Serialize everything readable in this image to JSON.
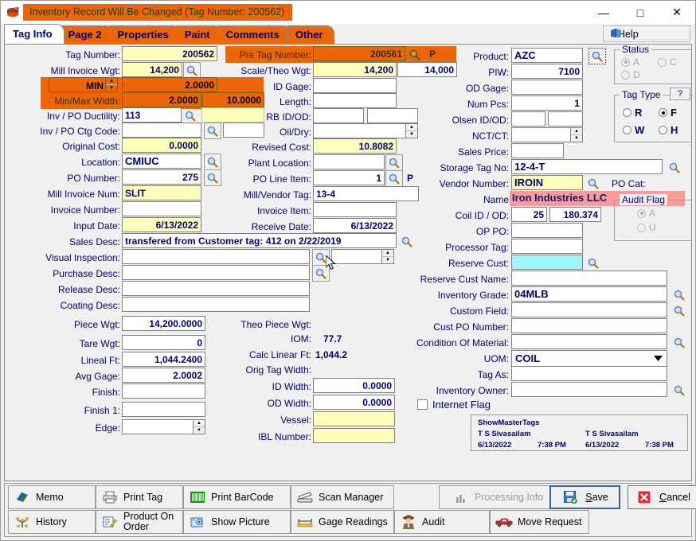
{
  "window": {
    "title": "Inventory Record Will Be Changed  (Tag Number: 200562)",
    "icon": "inventory-icon",
    "minimize": "—",
    "maximize": "□",
    "close": "✕"
  },
  "tabs": [
    {
      "label": "Tag Info",
      "active": true
    },
    {
      "label": "Page 2",
      "active": false
    },
    {
      "label": "Properties",
      "active": false
    },
    {
      "label": "Paint",
      "active": false
    },
    {
      "label": "Comments",
      "active": false
    },
    {
      "label": "Other",
      "active": false
    }
  ],
  "help": {
    "label": "Help"
  },
  "col1": {
    "tag_number": {
      "label": "Tag Number:",
      "value": "200562"
    },
    "mill_invoice_wgt": {
      "label": "Mill Invoice Wgt:",
      "value": "14,200"
    },
    "min": {
      "label": "MIN",
      "value": "2.0000"
    },
    "min_max_width": {
      "label": "Min/Max Width:",
      "min": "2.0000",
      "max": "10.0000"
    },
    "inv_po_ductility": {
      "label": "Inv / PO Ductility:",
      "value": "113",
      "value2": ""
    },
    "inv_po_ctg_code": {
      "label": "Inv / PO Ctg Code:",
      "value": "",
      "value2": ""
    },
    "original_cost": {
      "label": "Original Cost:",
      "value": "0.0000"
    },
    "location": {
      "label": "Location:",
      "value": "CMIUC"
    },
    "po_number": {
      "label": "PO Number:",
      "value": "275"
    },
    "mill_invoice_num": {
      "label": "Mill Invoice Num:",
      "value": "SLIT"
    },
    "invoice_number": {
      "label": "Invoice Number:",
      "value": ""
    },
    "input_date": {
      "label": "Input Date:",
      "value": "6/13/2022"
    },
    "sales_desc": {
      "label": "Sales Desc:",
      "value": "transfered from Customer tag: 412 on  2/22/2019"
    },
    "visual_inspection": {
      "label": "Visual Inspection:",
      "value": ""
    },
    "purchase_desc": {
      "label": "Purchase Desc:",
      "value": ""
    },
    "release_desc": {
      "label": "Release Desc:",
      "value": ""
    },
    "coating_desc": {
      "label": "Coating Desc:",
      "value": ""
    },
    "piece_wgt": {
      "label": "Piece Wgt:",
      "value": "14,200.0000"
    },
    "tare_wgt": {
      "label": "Tare Wgt:",
      "value": "0"
    },
    "lineal_ft": {
      "label": "Lineal Ft:",
      "value": "1,044.2400"
    },
    "avg_gage": {
      "label": "Avg Gage:",
      "value": "2.0002"
    },
    "finish": {
      "label": "Finish:",
      "value": ""
    },
    "finish_1": {
      "label": "Finish 1:",
      "value": ""
    },
    "edge": {
      "label": "Edge:",
      "value": ""
    }
  },
  "col2": {
    "pre_tag_number": {
      "label": "Pre Tag Number:",
      "value": "200561",
      "suffix": "P"
    },
    "scale_theo_wgt": {
      "label": "Scale/Theo Wgt:",
      "scale": "14,200",
      "theo": "14,000"
    },
    "id_gage": {
      "label": "ID Gage:",
      "value": ""
    },
    "length": {
      "label": "Length:",
      "value": ""
    },
    "rb_id_od": {
      "label": "RB ID/OD:",
      "id": "",
      "od": ""
    },
    "oil_dry": {
      "label": "Oil/Dry:",
      "value": ""
    },
    "revised_cost": {
      "label": "Revised Cost:",
      "value": "10.8082"
    },
    "plant_location": {
      "label": "Plant Location:",
      "value": ""
    },
    "po_line_item": {
      "label": "PO Line Item:",
      "value": "1",
      "suffix": "P"
    },
    "mill_vendor_tag": {
      "label": "Mill/Vendor Tag:",
      "value": "13-4"
    },
    "invoice_item": {
      "label": "Invoice Item:",
      "value": ""
    },
    "receive_date": {
      "label": "Receive Date:",
      "value": "6/13/2022"
    },
    "theo_piece_wgt": {
      "label": "Theo Piece Wgt:",
      "value": ""
    },
    "iom": {
      "label": "IOM:",
      "value": "77.7"
    },
    "calc_linear_ft": {
      "label": "Calc Linear Ft:",
      "value": "1,044.2"
    },
    "orig_tag_width": {
      "label": "Orig Tag Width:",
      "value": ""
    },
    "id_width": {
      "label": "ID Width:",
      "value": "0.0000"
    },
    "od_width": {
      "label": "OD Width:",
      "value": "0.0000"
    },
    "vessel": {
      "label": "Vessel:",
      "value": ""
    },
    "ibl_number": {
      "label": "IBL Number:",
      "value": ""
    }
  },
  "col3": {
    "product": {
      "label": "Product:",
      "value": "AZC"
    },
    "piw": {
      "label": "PIW:",
      "value": "7100"
    },
    "od_gage": {
      "label": "OD Gage:",
      "value": ""
    },
    "num_pcs": {
      "label": "Num Pcs:",
      "value": "1"
    },
    "olsen_id_od": {
      "label": "Olsen ID/OD:",
      "id": "",
      "od": ""
    },
    "nct_ct": {
      "label": "NCT/CT:",
      "value": ""
    },
    "sales_price": {
      "label": "Sales Price:",
      "value": ""
    },
    "storage_tag_no": {
      "label": "Storage Tag No:",
      "value": "12-4-T"
    },
    "vendor_number": {
      "label": "Vendor Number:",
      "value": "IROIN"
    },
    "po_cat": {
      "label": "PO Cat:",
      "value": ""
    },
    "name": {
      "label": "Name",
      "value": "Iron Industries LLC"
    },
    "coil_id_od": {
      "label": "Coil ID / OD:",
      "id": "25",
      "od": "180.374"
    },
    "op_po": {
      "label": "OP PO:",
      "value": ""
    },
    "processor_tag": {
      "label": "Processor Tag:",
      "value": ""
    },
    "reserve_cust": {
      "label": "Reserve Cust:",
      "value": ""
    },
    "reserve_cust_name": {
      "label": "Reserve Cust Name:",
      "value": ""
    },
    "inventory_grade": {
      "label": "Inventory Grade:",
      "value": "04MLB"
    },
    "custom_field": {
      "label": "Custom Field:",
      "value": ""
    },
    "cust_po_number": {
      "label": "Cust PO Number:",
      "value": ""
    },
    "condition_of_material": {
      "label": "Condition Of Material:",
      "value": ""
    },
    "uom": {
      "label": "UOM:",
      "value": "COIL"
    },
    "tag_as": {
      "label": "Tag As:",
      "value": ""
    },
    "inventory_owner": {
      "label": "Inventory Owner:",
      "value": ""
    },
    "internet_flag": {
      "label": "Internet Flag",
      "checked": false
    }
  },
  "status_group": {
    "title": "Status",
    "options": [
      {
        "label": "A",
        "selected": true
      },
      {
        "label": "C",
        "selected": false
      },
      {
        "label": "D",
        "selected": false
      }
    ]
  },
  "tag_type_group": {
    "title": "Tag Type",
    "help": "?",
    "options": [
      {
        "label": "R",
        "selected": false
      },
      {
        "label": "F",
        "selected": true
      },
      {
        "label": "W",
        "selected": false
      },
      {
        "label": "H",
        "selected": false
      }
    ]
  },
  "audit_flag_group": {
    "title": "Audit Flag",
    "options": [
      {
        "label": "A",
        "selected": true
      },
      {
        "label": "U",
        "selected": false
      }
    ]
  },
  "audit_info": {
    "title": "ShowMasterTags",
    "user1": "T S Sivasailam",
    "user2": "T S Sivasailam",
    "date1": "6/13/2022",
    "time1": "7:38 PM",
    "date2": "6/13/2022",
    "time2": "7:38 PM"
  },
  "toolbar": {
    "row1": [
      {
        "label": "Memo",
        "icon": "memo-icon"
      },
      {
        "label": "Print Tag",
        "icon": "printer-icon"
      },
      {
        "label": "Print BarCode",
        "icon": "barcode-icon"
      },
      {
        "label": "Scan Manager",
        "icon": "scanner-icon"
      }
    ],
    "row2": [
      {
        "label": "History",
        "icon": "history-tree-icon"
      },
      {
        "label": "Product On Order",
        "icon": "order-note-icon"
      },
      {
        "label": "Show Picture",
        "icon": "picture-icon"
      },
      {
        "label": "Gage Readings",
        "icon": "ruler-icon"
      },
      {
        "label": "Audit",
        "icon": "detective-icon"
      },
      {
        "label": "Move Request",
        "icon": "truck-icon"
      }
    ],
    "processing_info": {
      "label": "Processing Info",
      "icon": "chart-icon",
      "disabled": true
    },
    "save": {
      "label": "Save",
      "accel": "S",
      "icon": "save-disk-icon"
    },
    "cancel": {
      "label": "Cancel",
      "accel": "C",
      "icon": "cancel-x-icon"
    }
  },
  "colors": {
    "orange": "#ec6608",
    "yellow": "#ffffbb",
    "cyan": "#9ff5ff",
    "pink": "#f79a9a",
    "label_blue": "#00007a"
  }
}
